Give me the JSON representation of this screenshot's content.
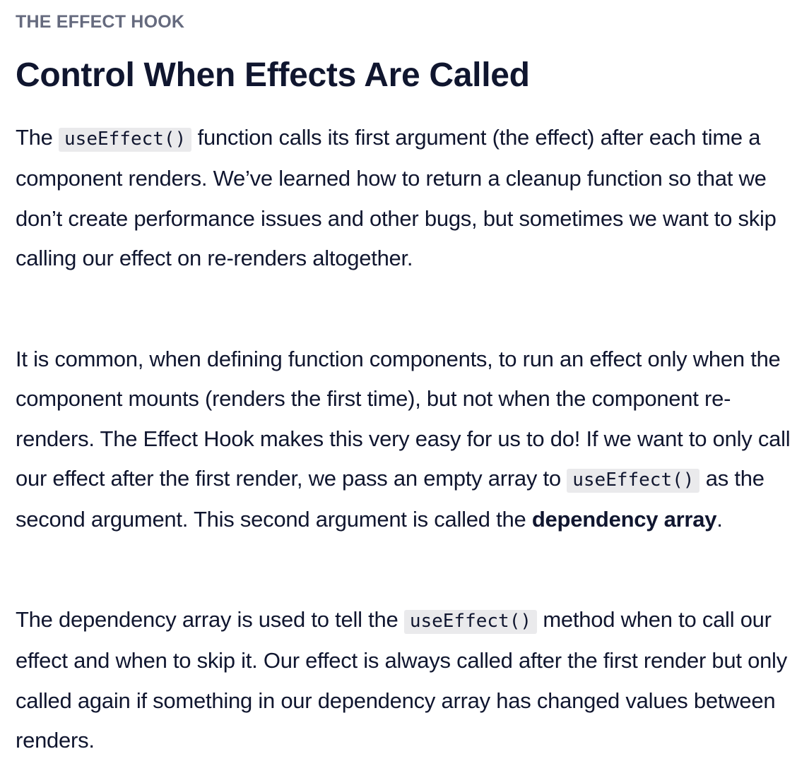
{
  "lesson": {
    "eyebrow": "THE EFFECT HOOK",
    "title": "Control When Effects Are Called",
    "paragraph_1": {
      "before_code": "The ",
      "code": "useEffect()",
      "after_code": " function calls its first argument (the effect) after each time a component renders. We’ve learned how to return a cleanup function so that we don’t create performance issues and other bugs, but sometimes we want to skip calling our effect on re-renders altogether."
    },
    "paragraph_2": {
      "before_code": "It is common, when defining function components, to run an effect only when the component mounts (renders the first time), but not when the component re-renders. The Effect Hook makes this very easy for us to do! If we want to only call our effect after the first render, we pass an empty array to ",
      "code": "useEffect()",
      "middle": " as the second argument. This second argument is called the ",
      "bold": "dependency array",
      "end": "."
    },
    "paragraph_3": {
      "before_code": "The dependency array is used to tell the ",
      "code": "useEffect()",
      "after_code": " method when to call our effect and when to skip it. Our effect is always called after the first render but only called again if something in our dependency array has changed values between renders."
    }
  }
}
